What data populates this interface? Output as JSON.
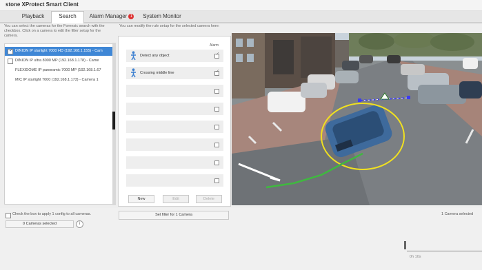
{
  "window": {
    "title": "stone XProtect Smart Client"
  },
  "tabs": [
    {
      "label": "Playback"
    },
    {
      "label": "Search"
    },
    {
      "label": "Alarm Manager"
    },
    {
      "label": "System Monitor"
    }
  ],
  "alarm_badge": "1",
  "left_panel": {
    "description": "You can select the cameras for the Forensic search with the checkbox. Click on a camera to edit the filter setup for the camera.",
    "cameras": [
      {
        "label": "DINION IP starlight 7000 HD (192.168.1.155) - Cam",
        "checked": true,
        "selected": true
      },
      {
        "label": "DINION IP ultra 8000 MP (192.168.1.178) - Came",
        "checked": false,
        "selected": false
      },
      {
        "label": "FLEXIDOME IP panoramic 7000 MP (192.168.1.67",
        "checked": false,
        "selected": false
      },
      {
        "label": "MIC IP starlight 7000 (192.168.1.173) - Camera 1",
        "checked": false,
        "selected": false
      }
    ],
    "apply_all_label": "Check the box to apply 1 config to all cameras.",
    "cameras_selected_button": "0 Cameras selected",
    "info_icon": "i"
  },
  "rules_panel": {
    "description": "You can modify the rule setup for the selected camera here:",
    "alarm_header": "Alarm",
    "rules": [
      {
        "label": "Detect any object",
        "icon": "person-icon",
        "checked": true
      },
      {
        "label": "Crossing middle line",
        "icon": "person-icon",
        "checked": true
      },
      {
        "label": "",
        "checked": false
      },
      {
        "label": "",
        "checked": false
      },
      {
        "label": "",
        "checked": false
      },
      {
        "label": "",
        "checked": false
      },
      {
        "label": "",
        "checked": false
      },
      {
        "label": "",
        "checked": false
      }
    ],
    "buttons": {
      "new": "New",
      "edit": "Edit",
      "delete": "Delete"
    },
    "set_filter_button": "Set filter for 1 Camera"
  },
  "status": {
    "cameras_selected_text": "1 Camera selected"
  },
  "timeline": {
    "label": "0h 10s"
  },
  "colors": {
    "selection": "#3f87d6",
    "crossing_line": "#3c3cf0",
    "trajectory": "#3fb93f",
    "object_outline": "#f0e020"
  }
}
